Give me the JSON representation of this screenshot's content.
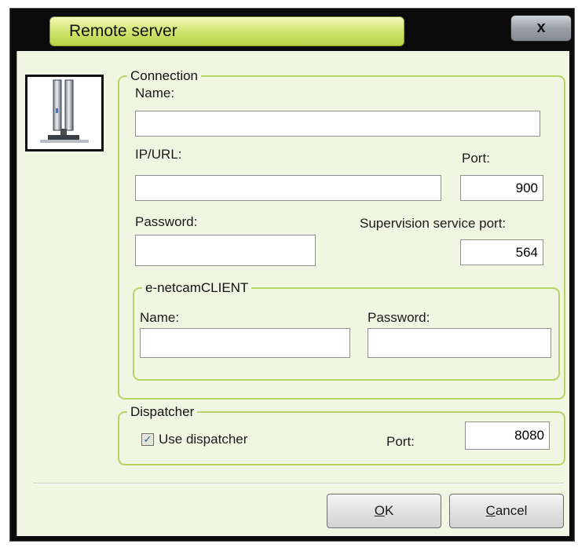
{
  "window": {
    "title": "Remote server",
    "close_label": "x"
  },
  "connection": {
    "legend": "Connection",
    "name_label": "Name:",
    "name_value": "",
    "ip_label": "IP/URL:",
    "ip_value": "",
    "port_label": "Port:",
    "port_value": "900",
    "password_label": "Password:",
    "password_value": "",
    "supervision_label": "Supervision service port:",
    "supervision_value": "564"
  },
  "client": {
    "legend": "e-netcamCLIENT",
    "name_label": "Name:",
    "name_value": "",
    "password_label": "Password:",
    "password_value": ""
  },
  "dispatcher": {
    "legend": "Dispatcher",
    "use_label": "Use dispatcher",
    "use_checked": true,
    "check_glyph": "✓",
    "port_label": "Port:",
    "port_value": "8080"
  },
  "buttons": {
    "ok_mnemonic": "O",
    "ok_rest": "K",
    "cancel_mnemonic": "C",
    "cancel_rest": "ancel"
  },
  "colors": {
    "title_accent": "#cde36a",
    "group_border": "#b5d465",
    "client_bg": "#f1f6e3"
  },
  "icons": {
    "server": "server-tower-icon"
  }
}
